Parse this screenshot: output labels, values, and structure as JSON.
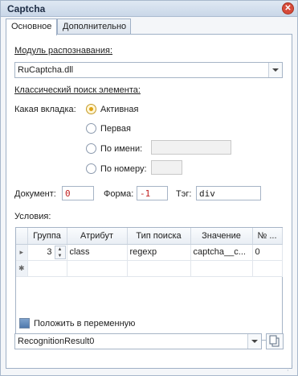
{
  "window": {
    "title": "Captcha",
    "close_glyph": "✕"
  },
  "tabs": [
    {
      "label": "Основное",
      "active": true
    },
    {
      "label": "Дополнительно",
      "active": false
    }
  ],
  "recognition": {
    "label": "Модуль распознавания:",
    "selected": "RuCaptcha.dll"
  },
  "classic_search": {
    "label": "Классический поиск элемента:",
    "which_tab_label": "Какая вкладка:",
    "options": [
      {
        "label": "Активная",
        "checked": true
      },
      {
        "label": "Первая",
        "checked": false
      },
      {
        "label": "По имени:",
        "checked": false
      },
      {
        "label": "По номеру:",
        "checked": false
      }
    ],
    "by_name_value": "",
    "by_number_value": ""
  },
  "fields": {
    "document_label": "Документ:",
    "document_value": "0",
    "form_label": "Форма:",
    "form_value": "-1",
    "tag_label": "Тэг:",
    "tag_value": "div"
  },
  "conditions": {
    "label": "Условия:",
    "columns": [
      "Группа",
      "Атрибут",
      "Тип поиска",
      "Значение",
      "№ ..."
    ],
    "rows": [
      {
        "indicator": "▸",
        "group": "3",
        "attribute": "class",
        "search_type": "regexp",
        "value": "captcha__c...",
        "number": "0"
      }
    ],
    "new_row_indicator": "✱"
  },
  "save_to_variable": {
    "label": "Положить в переменную",
    "variable": "RecognitionResult0"
  },
  "colors": {
    "accent": "#e0a314",
    "checkbox": "#4f79ad",
    "border": "#a6b4c6"
  },
  "icons": {
    "close": "close-icon",
    "dropdown": "chevron-down-icon",
    "copy": "copy-icon",
    "resize": "resize-grip-icon"
  }
}
